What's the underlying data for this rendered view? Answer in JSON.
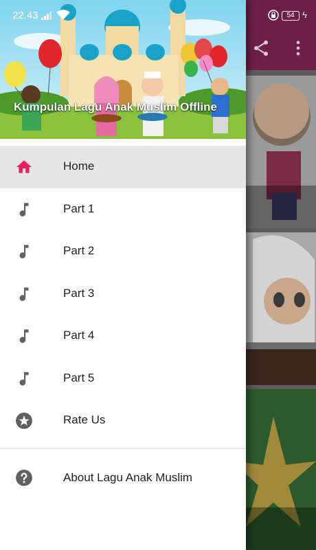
{
  "status_bar": {
    "time": "22.43",
    "battery": "54"
  },
  "drawer": {
    "title": "Kumpulan Lagu Anak Muslim Offline",
    "items": [
      {
        "label": "Home",
        "icon": "home-icon",
        "active": true
      },
      {
        "label": "Part 1",
        "icon": "music-note-icon"
      },
      {
        "label": "Part 2",
        "icon": "music-note-icon"
      },
      {
        "label": "Part 3",
        "icon": "music-note-icon"
      },
      {
        "label": "Part 4",
        "icon": "music-note-icon"
      },
      {
        "label": "Part 5",
        "icon": "music-note-icon"
      },
      {
        "label": "Rate Us",
        "icon": "star-icon"
      }
    ],
    "about": {
      "label": "About Lagu Anak Muslim",
      "icon": "help-icon"
    }
  },
  "colors": {
    "accent": "#e91e63",
    "toolbar": "#6e1f45",
    "icon_gray": "#616161",
    "active_bg": "#e6e6e6"
  }
}
